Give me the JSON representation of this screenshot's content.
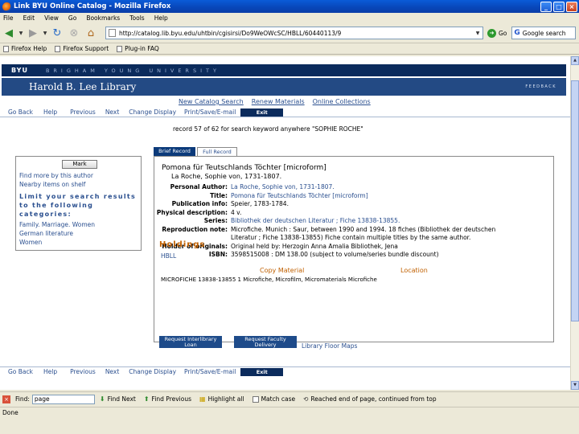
{
  "window": {
    "title": "Link BYU Online Catalog - Mozilla Firefox"
  },
  "menu": [
    "File",
    "Edit",
    "View",
    "Go",
    "Bookmarks",
    "Tools",
    "Help"
  ],
  "address": {
    "url": "http://catalog.lib.byu.edu/uhtbin/cgisirsi/Do9WeOWcSC/HBLL/60440113/9",
    "go_label": "Go"
  },
  "search": {
    "value": "Google search"
  },
  "bookmarks": [
    "Firefox Help",
    "Firefox Support",
    "Plug-in FAQ"
  ],
  "page": {
    "byu": "BYU",
    "university": "BRIGHAM YOUNG UNIVERSITY",
    "library_name": "Harold B. Lee Library",
    "feedback": "FEEDBACK",
    "top_links": [
      "New Catalog Search",
      "Renew Materials",
      "Online Collections"
    ],
    "nav": [
      "Go Back",
      "Help",
      "Previous",
      "Next",
      "Change Display",
      "Print/Save/E-mail",
      "Exit"
    ],
    "record_line": "record 57 of 62 for search keyword anywhere \"SOPHIE ROCHE\"",
    "sidebar": {
      "mark": "Mark",
      "find_more": "Find more by this author",
      "nearby": "Nearby items on shelf",
      "limit": "Limit your search results to the following categories:",
      "categories": [
        "Family. Marriage. Women",
        "German literature",
        "Women"
      ]
    },
    "tabs": {
      "brief": "Brief Record",
      "full": "Full Record"
    },
    "record": {
      "title": "Pomona für Teutschlands Töchter [microform]",
      "author_line": "La Roche, Sophie von, 1731-1807.",
      "fields": [
        {
          "label": "Personal Author:",
          "value": "La Roche, Sophie von, 1731-1807.",
          "link": true
        },
        {
          "label": "Title:",
          "value": "Pomona für Teutschlands Töchter [microform]",
          "link": true
        },
        {
          "label": "Publication info:",
          "value": "Speier, 1783-1784.",
          "link": false
        },
        {
          "label": "Physical description:",
          "value": "4 v.",
          "link": false
        },
        {
          "label": "Series:",
          "value": "Bibliothek der deutschen Literatur ; Fiche 13838-13855.",
          "link": true
        },
        {
          "label": "Reproduction note:",
          "value": "Microfiche. Munich : Saur, between 1990 and 1994. 18 fiches (Bibliothek der deutschen Literatur ; Fiche 13838-13855) Fiche contain multiple titles by the same author.",
          "link": false
        },
        {
          "label": "Holder of originals:",
          "value": "Original held by: Herzogin Anna Amalia Bibliothek, Jena",
          "link": false
        },
        {
          "label": "ISBN:",
          "value": "3598515008 : DM 138.00 (subject to volume/series bundle discount)",
          "link": false
        }
      ]
    },
    "holdings": {
      "heading": "Holdings",
      "location": "HBLL",
      "columns": [
        "Copy Material",
        "Location"
      ],
      "row": "MICROFICHE 13838-13855   1  Microfiche, Microfilm, Micromaterials   Microfiche"
    },
    "buttons": {
      "ill": "Request Interlibrary Loan",
      "faculty": "Request Faculty Delivery"
    },
    "floor_maps": "Library Floor Maps"
  },
  "findbar": {
    "label": "Find:",
    "value": "page",
    "next": "Find Next",
    "previous": "Find Previous",
    "highlight": "Highlight all",
    "match_case": "Match case",
    "message": "Reached end of page, continued from top"
  },
  "status": "Done"
}
